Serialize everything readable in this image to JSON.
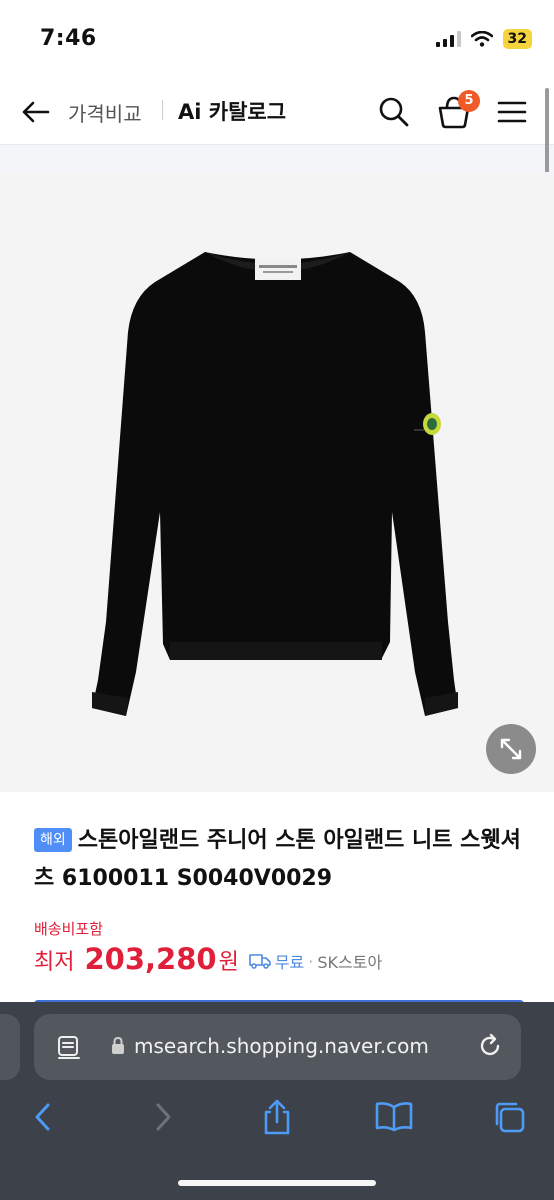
{
  "status": {
    "time": "7:46",
    "battery": "32"
  },
  "header": {
    "back_icon": "arrow-left-icon",
    "crumb": "가격비교",
    "catalog": "Ai 카탈로그",
    "cart_count": "5"
  },
  "product": {
    "badge": "해외",
    "title": "스톤아일랜드 주니어 스톤 아일랜드 니트 스웻셔츠 6100011 S0040V0029",
    "shipping_note": "배송비포함",
    "price_label": "최저",
    "price": "203,280",
    "currency": "원",
    "delivery": "무료",
    "seller": "SK스토아"
  },
  "browser": {
    "url": "msearch.shopping.naver.com"
  },
  "colors": {
    "accent": "#e0203a",
    "badge": "#4f8ef7",
    "cart_badge": "#f05a28"
  }
}
